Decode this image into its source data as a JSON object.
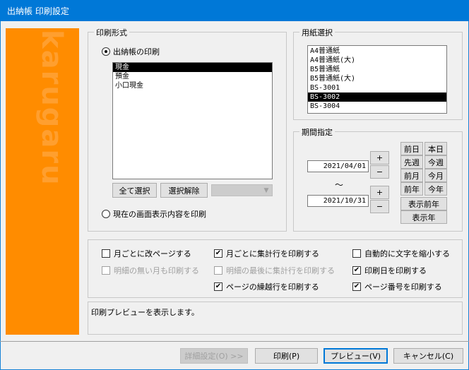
{
  "window": {
    "title": "出納帳 印刷設定"
  },
  "brand": {
    "text": "karugaru"
  },
  "print_format": {
    "legend": "印刷形式",
    "option_ledger": "出納帳の印刷",
    "accounts": [
      {
        "label": "現金",
        "selected": true
      },
      {
        "label": "預金",
        "selected": false
      },
      {
        "label": "小口現金",
        "selected": false
      }
    ],
    "select_all": "全て選択",
    "deselect": "選択解除",
    "combo_value": "",
    "option_screen": "現在の画面表示内容を印刷"
  },
  "paper": {
    "legend": "用紙選択",
    "items": [
      {
        "label": "A4普通紙",
        "selected": false
      },
      {
        "label": "A4普通紙(大)",
        "selected": false
      },
      {
        "label": "B5普通紙",
        "selected": false
      },
      {
        "label": "B5普通紙(大)",
        "selected": false
      },
      {
        "label": "BS-3001",
        "selected": false
      },
      {
        "label": "BS-3002",
        "selected": true
      },
      {
        "label": "BS-3004",
        "selected": false
      }
    ]
  },
  "period": {
    "legend": "期間指定",
    "start_date": "2021/04/01",
    "end_date": "2021/10/31",
    "tilde": "～",
    "plus": "+",
    "minus": "−",
    "prev_day": "前日",
    "today": "本日",
    "prev_week": "先週",
    "this_week": "今週",
    "prev_month": "前月",
    "this_month": "今月",
    "prev_year": "前年",
    "this_year": "今年",
    "prev_display_year": "表示前年",
    "display_year": "表示年"
  },
  "options": [
    {
      "label": "月ごとに改ページする",
      "checked": false,
      "enabled": true
    },
    {
      "label": "月ごとに集計行を印刷する",
      "checked": true,
      "enabled": true
    },
    {
      "label": "自動的に文字を縮小する",
      "checked": false,
      "enabled": true
    },
    {
      "label": "明細の無い月も印刷する",
      "checked": false,
      "enabled": false
    },
    {
      "label": "明細の最後に集計行を印刷する",
      "checked": false,
      "enabled": false
    },
    {
      "label": "印刷日を印刷する",
      "checked": true,
      "enabled": true
    },
    {
      "label": "ページの繰越行を印刷する",
      "checked": true,
      "enabled": true
    },
    {
      "label": "ページ番号を印刷する",
      "checked": true,
      "enabled": true
    }
  ],
  "status": {
    "text": "印刷プレビューを表示します。"
  },
  "footer": {
    "details": "詳細設定(O) >>",
    "print": "印刷(P)",
    "preview": "プレビュー(V)",
    "cancel": "キャンセル(C)"
  },
  "colors": {
    "titlebar": "#0078d7",
    "brand": "#ff8c00",
    "selection": "#000000"
  }
}
